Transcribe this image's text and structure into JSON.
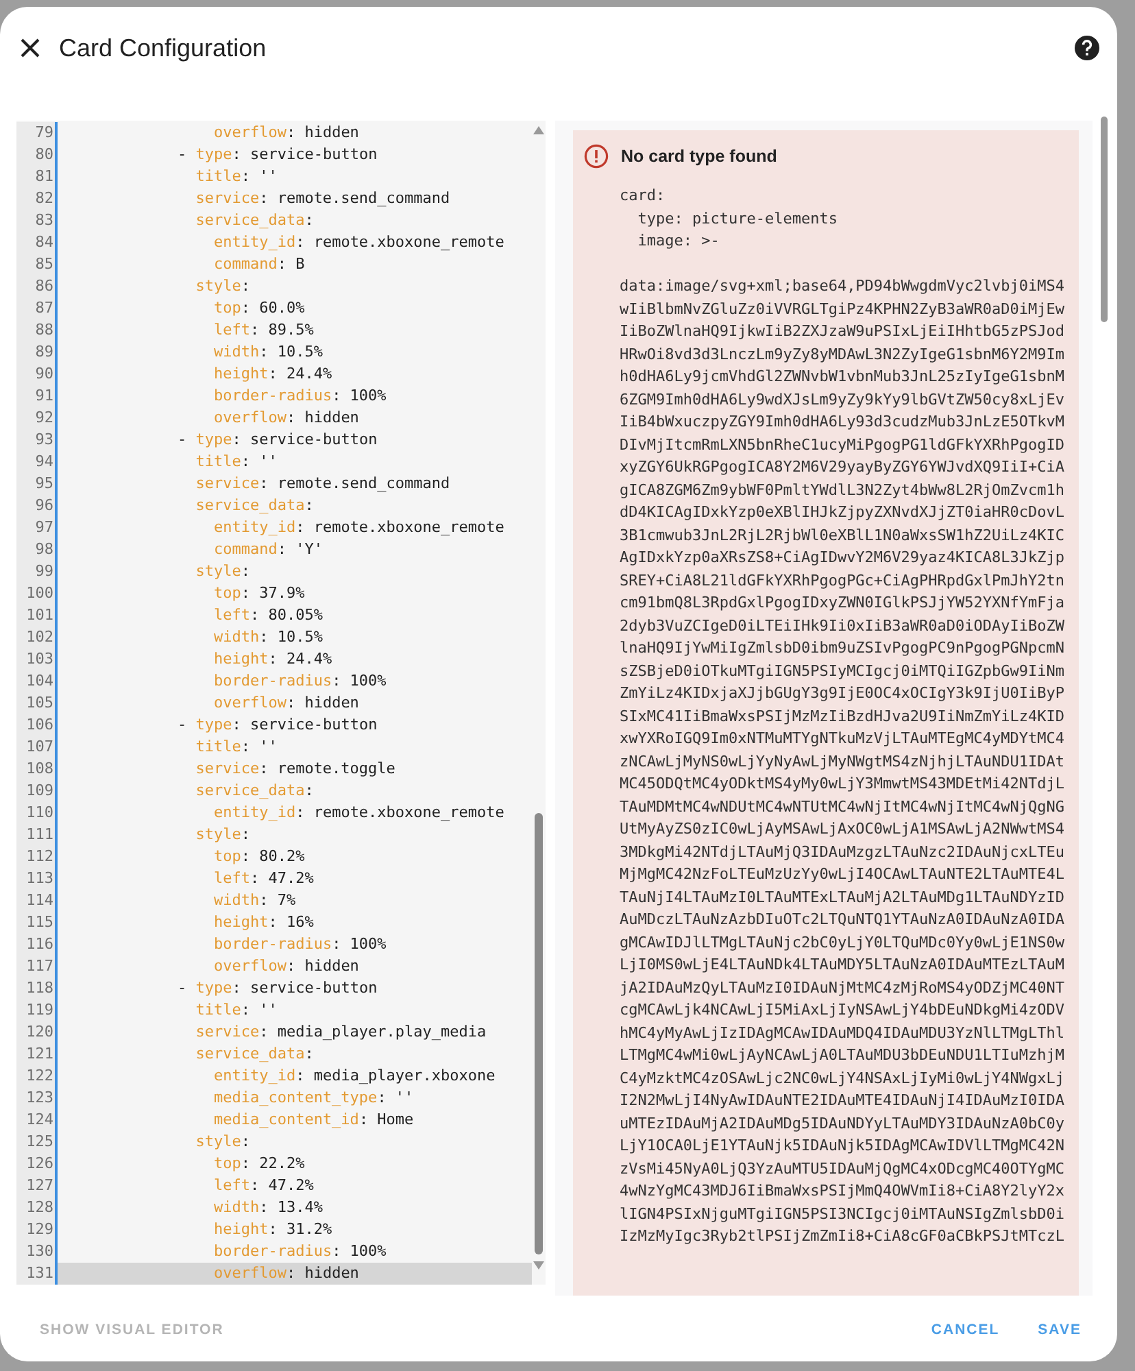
{
  "dialog": {
    "title": "Card Configuration"
  },
  "editor": {
    "lines": [
      {
        "number": "79",
        "key": "                overflow:",
        "value": "hidden",
        "current": false
      },
      {
        "number": "80",
        "marker": "-",
        "key": "            type:",
        "value": "service-button",
        "current": false
      },
      {
        "number": "81",
        "key": "              title:",
        "value": "''",
        "current": false
      },
      {
        "number": "82",
        "key": "              service:",
        "value": "remote.send_command",
        "current": false
      },
      {
        "number": "83",
        "key": "              service_data:",
        "current": false
      },
      {
        "number": "84",
        "key": "                entity_id:",
        "value": "remote.xboxone_remote",
        "current": false
      },
      {
        "number": "85",
        "key": "                command:",
        "value": "B",
        "current": false
      },
      {
        "number": "86",
        "key": "              style:",
        "current": false
      },
      {
        "number": "87",
        "key": "                top:",
        "value": "60.0%",
        "current": false
      },
      {
        "number": "88",
        "key": "                left:",
        "value": "89.5%",
        "current": false
      },
      {
        "number": "89",
        "key": "                width:",
        "value": "10.5%",
        "current": false
      },
      {
        "number": "90",
        "key": "                height:",
        "value": "24.4%",
        "current": false
      },
      {
        "number": "91",
        "key": "                border-radius:",
        "value": "100%",
        "current": false
      },
      {
        "number": "92",
        "key": "                overflow:",
        "value": "hidden",
        "current": false
      },
      {
        "number": "93",
        "marker": "-",
        "key": "            type:",
        "value": "service-button",
        "current": false
      },
      {
        "number": "94",
        "key": "              title:",
        "value": "''",
        "current": false
      },
      {
        "number": "95",
        "key": "              service:",
        "value": "remote.send_command",
        "current": false
      },
      {
        "number": "96",
        "key": "              service_data:",
        "current": false
      },
      {
        "number": "97",
        "key": "                entity_id:",
        "value": "remote.xboxone_remote",
        "current": false
      },
      {
        "number": "98",
        "key": "                command:",
        "value": "'Y'",
        "current": false
      },
      {
        "number": "99",
        "key": "              style:",
        "current": false
      },
      {
        "number": "100",
        "key": "                top:",
        "value": "37.9%",
        "current": false
      },
      {
        "number": "101",
        "key": "                left:",
        "value": "80.05%",
        "current": false
      },
      {
        "number": "102",
        "key": "                width:",
        "value": "10.5%",
        "current": false
      },
      {
        "number": "103",
        "key": "                height:",
        "value": "24.4%",
        "current": false
      },
      {
        "number": "104",
        "key": "                border-radius:",
        "value": "100%",
        "current": false
      },
      {
        "number": "105",
        "key": "                overflow:",
        "value": "hidden",
        "current": false
      },
      {
        "number": "106",
        "marker": "-",
        "key": "            type:",
        "value": "service-button",
        "current": false
      },
      {
        "number": "107",
        "key": "              title:",
        "value": "''",
        "current": false
      },
      {
        "number": "108",
        "key": "              service:",
        "value": "remote.toggle",
        "current": false
      },
      {
        "number": "109",
        "key": "              service_data:",
        "current": false
      },
      {
        "number": "110",
        "key": "                entity_id:",
        "value": "remote.xboxone_remote",
        "current": false
      },
      {
        "number": "111",
        "key": "              style:",
        "current": false
      },
      {
        "number": "112",
        "key": "                top:",
        "value": "80.2%",
        "current": false
      },
      {
        "number": "113",
        "key": "                left:",
        "value": "47.2%",
        "current": false
      },
      {
        "number": "114",
        "key": "                width:",
        "value": "7%",
        "current": false
      },
      {
        "number": "115",
        "key": "                height:",
        "value": "16%",
        "current": false
      },
      {
        "number": "116",
        "key": "                border-radius:",
        "value": "100%",
        "current": false
      },
      {
        "number": "117",
        "key": "                overflow:",
        "value": "hidden",
        "current": false
      },
      {
        "number": "118",
        "marker": "-",
        "key": "            type:",
        "value": "service-button",
        "current": false
      },
      {
        "number": "119",
        "key": "              title:",
        "value": "''",
        "current": false
      },
      {
        "number": "120",
        "key": "              service:",
        "value": "media_player.play_media",
        "current": false
      },
      {
        "number": "121",
        "key": "              service_data:",
        "current": false
      },
      {
        "number": "122",
        "key": "                entity_id:",
        "value": "media_player.xboxone",
        "current": false
      },
      {
        "number": "123",
        "key": "                media_content_type:",
        "value": "''",
        "current": false
      },
      {
        "number": "124",
        "key": "                media_content_id:",
        "value": "Home",
        "current": false
      },
      {
        "number": "125",
        "key": "              style:",
        "current": false
      },
      {
        "number": "126",
        "key": "                top:",
        "value": "22.2%",
        "current": false
      },
      {
        "number": "127",
        "key": "                left:",
        "value": "47.2%",
        "current": false
      },
      {
        "number": "128",
        "key": "                width:",
        "value": "13.4%",
        "current": false
      },
      {
        "number": "129",
        "key": "                height:",
        "value": "31.2%",
        "current": false
      },
      {
        "number": "130",
        "key": "                border-radius:",
        "value": "100%",
        "current": false
      },
      {
        "number": "131",
        "key": "                overflow:",
        "value": "hidden",
        "current": true
      }
    ]
  },
  "preview": {
    "error_title": "No card type found",
    "config_lines": [
      "card:",
      "  type: picture-elements",
      "  image: >-"
    ],
    "image_data_lines": [
      "data:image/svg+xml;base64,PD94bWwgdmVyc2lvbj0iMS4",
      "wIiBlbmNvZGluZz0iVVRGLTgiPz4KPHN2ZyB3aWR0aD0iMjEw",
      "IiBoZWlnaHQ9IjkwIiB2ZXJzaW9uPSIxLjEiIHhtbG5zPSJod",
      "HRwOi8vd3d3LnczLm9yZy8yMDAwL3N2ZyIgeG1sbnM6Y2M9Im",
      "h0dHA6Ly9jcmVhdGl2ZWNvbW1vbnMub3JnL25zIyIgeG1sbnM",
      "6ZGM9Imh0dHA6Ly9wdXJsLm9yZy9kYy9lbGVtZW50cy8xLjEv",
      "IiB4bWxuczpyZGY9Imh0dHA6Ly93d3cudzMub3JnLzE5OTkvM",
      "DIvMjItcmRmLXN5bnRheC1ucyMiPgogPG1ldGFkYXRhPgogID",
      "xyZGY6UkRGPgogICA8Y2M6V29yayByZGY6YWJvdXQ9IiI+CiA",
      "gICA8ZGM6Zm9ybWF0PmltYWdlL3N2Zyt4bWw8L2RjOmZvcm1h",
      "dD4KICAgIDxkYzp0eXBlIHJkZjpyZXNvdXJjZT0iaHR0cDovL",
      "3B1cmwub3JnL2RjL2RjbWl0eXBlL1N0aWxsSW1hZ2UiLz4KIC",
      "AgIDxkYzp0aXRsZS8+CiAgIDwvY2M6V29yaz4KICA8L3JkZjp",
      "SREY+CiA8L21ldGFkYXRhPgogPGc+CiAgPHRpdGxlPmJhY2tn",
      "cm91bmQ8L3RpdGxlPgogIDxyZWN0IGlkPSJjYW52YXNfYmFja",
      "2dyb3VuZCIgeD0iLTEiIHk9Ii0xIiB3aWR0aD0iODAyIiBoZW",
      "lnaHQ9IjYwMiIgZmlsbD0ibm9uZSIvPgogPC9nPgogPGNpcmN",
      "sZSBjeD0iOTkuMTgiIGN5PSIyMCIgcj0iMTQiIGZpbGw9IiNm",
      "ZmYiLz4KIDxjaXJjbGUgY3g9IjE0OC4xOCIgY3k9IjU0IiByP",
      "SIxMC41IiBmaWxsPSIjMzMzIiBzdHJva2U9IiNmZmYiLz4KID",
      "xwYXRoIGQ9Im0xNTMuMTYgNTkuMzVjLTAuMTEgMC4yMDYtMC4",
      "zNCAwLjMyNS0wLjYyNyAwLjMyNWgtMS4zNjhjLTAuNDU1IDAt",
      "MC45ODQtMC4yODktMS4yMy0wLjY3MmwtMS43MDEtMi42NTdjL",
      "TAuMDMtMC4wNDUtMC4wNTUtMC4wNjItMC4wNjItMC4wNjQgNG",
      "UtMyAyZS0zIC0wLjAyMSAwLjAxOC0wLjA1MSAwLjA2NWwtMS4",
      "3MDkgMi42NTdjLTAuMjQ3IDAuMzgzLTAuNzc2IDAuNjcxLTEu",
      "MjMgMC42NzFoLTEuMzUzYy0wLjI4OCAwLTAuNTE2LTAuMTE4L",
      "TAuNjI4LTAuMzI0LTAuMTExLTAuMjA2LTAuMDg1LTAuNDYzID",
      "AuMDczLTAuNzAzbDIuOTc2LTQuNTQ1YTAuNzA0IDAuNzA0IDA",
      "gMCAwIDJlLTMgLTAuNjc2bC0yLjY0LTQuMDc0Yy0wLjE1NS0w",
      "LjI0MS0wLjE4LTAuNDk4LTAuMDY5LTAuNzA0IDAuMTEzLTAuM",
      "jA2IDAuMzQyLTAuMzI0IDAuNjMtMC4zMjRoMS4yODZjMC40NT",
      "cgMCAwLjk4NCAwLjI5MiAxLjIyNSAwLjY4bDEuNDkgMi4zODV",
      "hMC4yMyAwLjIzIDAgMCAwIDAuMDQ4IDAuMDU3YzNlLTMgLThl",
      "LTMgMC4wMi0wLjAyNCAwLjA0LTAuMDU3bDEuNDU1LTIuMzhjM",
      "C4yMzktMC4zOSAwLjc2NC0wLjY4NSAxLjIyMi0wLjY4NWgxLj",
      "I2N2MwLjI4NyAwIDAuNTE2IDAuMTE4IDAuNjI4IDAuMzI0IDA",
      "uMTEzIDAuMjA2IDAuMDg5IDAuNDYyLTAuMDY3IDAuNzA0bC0y",
      "LjY1OCA0LjE1YTAuNjk5IDAuNjk5IDAgMCAwIDVlLTMgMC42N",
      "zVsMi45NyA0LjQ3YzAuMTU5IDAuMjQgMC4xODcgMC40OTYgMC",
      "4wNzYgMC43MDJ6IiBmaWxsPSIjMmQ4OWVmIi8+CiA8Y2lyY2x",
      "lIGN4PSIxNjguMTgiIGN5PSI3NCIgcj0iMTAuNSIgZmlsbD0i",
      "IzMzMyIgc3Ryb2tlPSIjZmZmIi8+CiA8cGF0aCBkPSJtMTczL"
    ]
  },
  "footer": {
    "left_button": "SHOW VISUAL EDITOR",
    "buttons": [
      "CANCEL",
      "SAVE"
    ]
  }
}
